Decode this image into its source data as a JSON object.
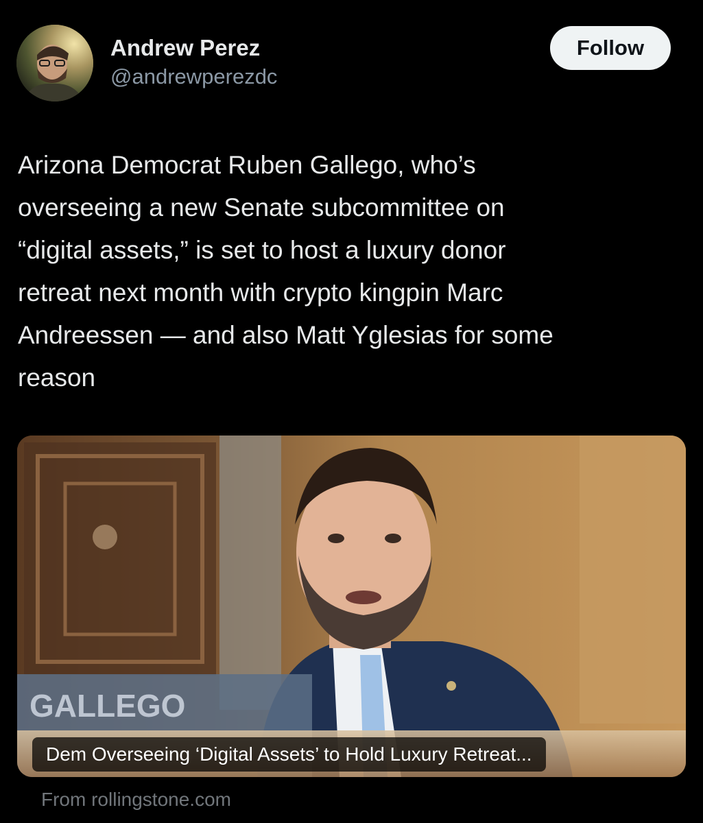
{
  "author": {
    "display_name": "Andrew Perez",
    "handle": "@andrewperezdc",
    "avatar_icon": "profile-photo"
  },
  "follow_button": {
    "label": "Follow"
  },
  "tweet": {
    "text": "Arizona Democrat Ruben Gallego, who’s\noverseeing a new Senate subcommittee on\n“digital assets,” is set to host a luxury donor\nretreat next month with crypto kingpin Marc\nAndreessen — and also Matt Yglesias for some\nreason"
  },
  "link_card": {
    "title": "Dem Overseeing ‘Digital Assets’ to Hold Luxury Retreat...",
    "nameplate_text": "GALLEGO",
    "source": "From rollingstone.com"
  },
  "colors": {
    "background": "#000000",
    "text_primary": "#e7e9ea",
    "text_secondary": "#71767b",
    "follow_button_bg": "#eff3f4"
  }
}
